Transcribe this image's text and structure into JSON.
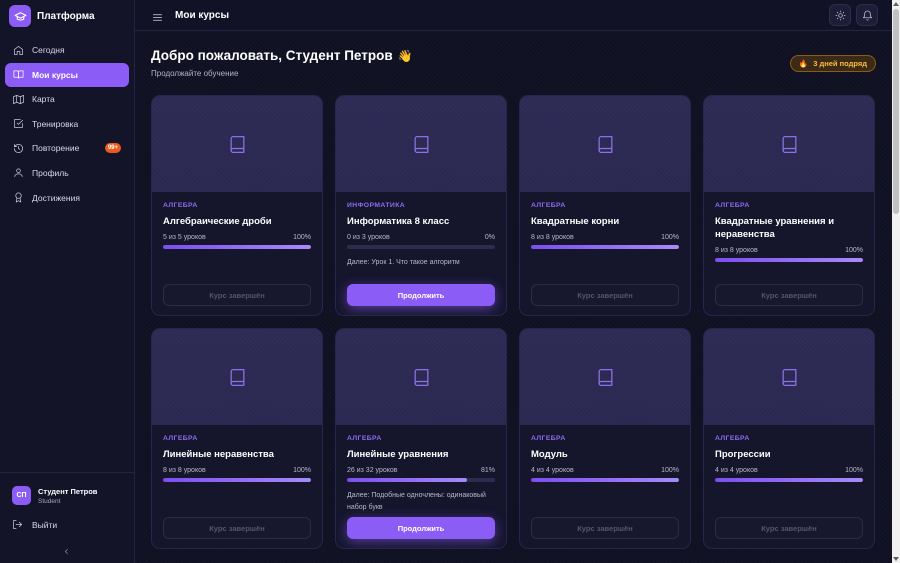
{
  "app": {
    "name": "Платформа",
    "page_title": "Мои курсы"
  },
  "sidebar": {
    "items": [
      {
        "label": "Сегодня",
        "icon": "home-icon",
        "active": false
      },
      {
        "label": "Мои курсы",
        "icon": "book-open-icon",
        "active": true
      },
      {
        "label": "Карта",
        "icon": "map-icon",
        "active": false
      },
      {
        "label": "Тренировка",
        "icon": "checkbox-icon",
        "active": false
      },
      {
        "label": "Повторение",
        "icon": "history-icon",
        "active": false,
        "badge": "99+"
      },
      {
        "label": "Профиль",
        "icon": "user-icon",
        "active": false
      },
      {
        "label": "Достижения",
        "icon": "trophy-icon",
        "active": false
      }
    ],
    "user": {
      "initials": "СП",
      "name": "Студент Петров",
      "role": "Student"
    },
    "logout_label": "Выйти"
  },
  "header": {
    "welcome": "Добро пожаловать, Студент Петров",
    "wave_emoji": "👋",
    "subtitle": "Продолжайте обучение",
    "streak_emoji": "🔥",
    "streak_label": "3 дней подряд"
  },
  "colors": {
    "accent": "#8b5cf6",
    "background": "#0f1021",
    "card": "#15152c",
    "streak": "#fbbf3c",
    "badge": "#ea5a1c"
  },
  "courses": [
    {
      "subject": "АЛГЕБРА",
      "title": "Алгебраические дроби",
      "lessons": "5 из 5 уроков",
      "percent_label": "100%",
      "progress": 1.0,
      "next": "",
      "button": "Курс завершён",
      "completed": true
    },
    {
      "subject": "ИНФОРМАТИКА",
      "title": "Информатика 8 класс",
      "lessons": "0 из 3 уроков",
      "percent_label": "0%",
      "progress": 0.0,
      "next": "Далее: Урок 1. Что такое алгоритм",
      "button": "Продолжить",
      "completed": false
    },
    {
      "subject": "АЛГЕБРА",
      "title": "Квадратные корни",
      "lessons": "8 из 8 уроков",
      "percent_label": "100%",
      "progress": 1.0,
      "next": "",
      "button": "Курс завершён",
      "completed": true
    },
    {
      "subject": "АЛГЕБРА",
      "title": "Квадратные уравнения и неравенства",
      "lessons": "8 из 8 уроков",
      "percent_label": "100%",
      "progress": 1.0,
      "next": "",
      "button": "Курс завершён",
      "completed": true
    },
    {
      "subject": "АЛГЕБРА",
      "title": "Линейные неравенства",
      "lessons": "8 из 8 уроков",
      "percent_label": "100%",
      "progress": 1.0,
      "next": "",
      "button": "Курс завершён",
      "completed": true
    },
    {
      "subject": "АЛГЕБРА",
      "title": "Линейные уравнения",
      "lessons": "26 из 32 уроков",
      "percent_label": "81%",
      "progress": 0.81,
      "next": "Далее: Подобные одночлены: одинаковый набор букв",
      "button": "Продолжить",
      "completed": false
    },
    {
      "subject": "АЛГЕБРА",
      "title": "Модуль",
      "lessons": "4 из 4 уроков",
      "percent_label": "100%",
      "progress": 1.0,
      "next": "",
      "button": "Курс завершён",
      "completed": true
    },
    {
      "subject": "АЛГЕБРА",
      "title": "Прогрессии",
      "lessons": "4 из 4 уроков",
      "percent_label": "100%",
      "progress": 1.0,
      "next": "",
      "button": "Курс завершён",
      "completed": true
    }
  ]
}
